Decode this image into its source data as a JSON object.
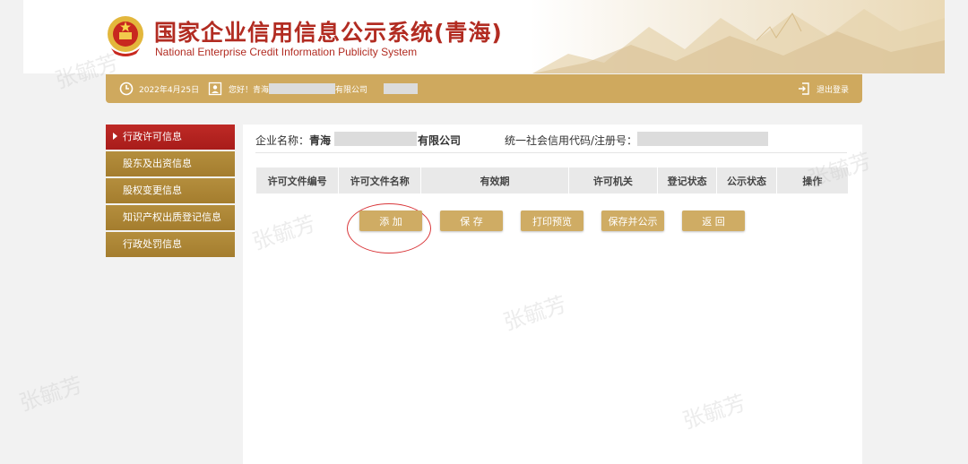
{
  "header": {
    "title_cn": "国家企业信用信息公示系统(青海)",
    "title_en": "National Enterprise Credit Information Publicity System"
  },
  "topbar": {
    "date": "2022年4月25日",
    "greeting_prefix": "您好！青海",
    "greeting_suffix": "有限公司",
    "logout": "退出登录"
  },
  "sidebar": {
    "items": [
      {
        "label": "行政许可信息",
        "active": true
      },
      {
        "label": "股东及出资信息",
        "active": false
      },
      {
        "label": "股权变更信息",
        "active": false
      },
      {
        "label": "知识产权出质登记信息",
        "active": false
      },
      {
        "label": "行政处罚信息",
        "active": false
      }
    ]
  },
  "main": {
    "company_label": "企业名称：",
    "company_prefix": "青海",
    "company_suffix": "有限公司",
    "code_label": "统一社会信用代码/注册号：",
    "table_headers": [
      "许可文件编号",
      "许可文件名称",
      "有效期",
      "许可机关",
      "登记状态",
      "公示状态",
      "操作"
    ],
    "buttons": {
      "add": "添 加",
      "save": "保 存",
      "print": "打印预览",
      "save_publish": "保存并公示",
      "back": "返 回"
    }
  },
  "watermark": "张毓芳",
  "colors": {
    "accent_gold": "#cfa95e",
    "sidebar_gold": "#a47d2e",
    "active_red": "#b22c22",
    "title_red": "#b22c22"
  }
}
